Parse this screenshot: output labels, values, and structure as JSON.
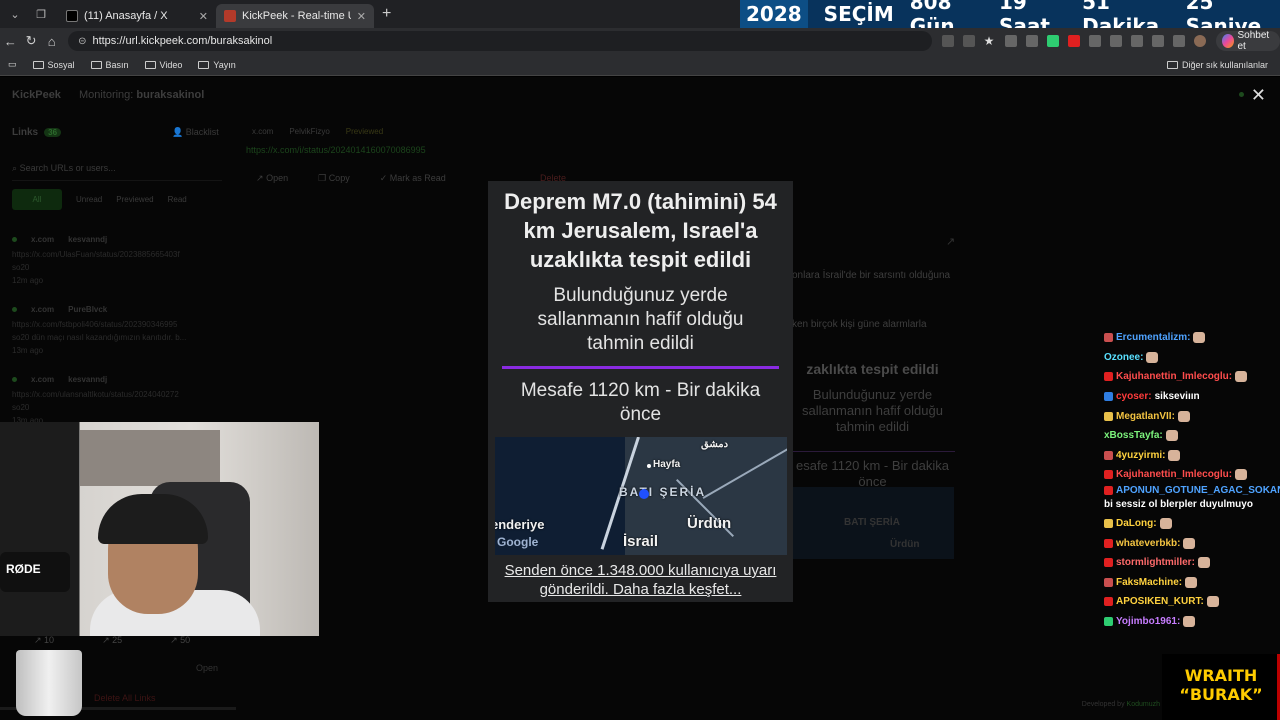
{
  "browser": {
    "tabs": [
      {
        "title": "(11) Anasayfa / X",
        "favicon_color": "#ffffff"
      },
      {
        "title": "KickPeek - Real-time URL Crawler",
        "favicon_color": "#b33a2a"
      }
    ],
    "url": "https://url.kickpeek.com/buraksakinol",
    "chat_button": "Sohbet et",
    "bookmarks": [
      "Sosyal",
      "Basın",
      "Video",
      "Yayın"
    ],
    "other_bookmarks": "Diğer sık kullanılanlar"
  },
  "countdown": {
    "year": "2028",
    "label": "SEÇİM",
    "days": "808 Gün",
    "hours": "19 Saat",
    "minutes": "51 Dakika",
    "seconds": "25 Saniye"
  },
  "app": {
    "name": "KickPeek",
    "monitoring_label": "Monitoring:",
    "monitoring_user": "buraksakinol",
    "links_label": "Links",
    "links_count": "36",
    "blacklist": "Blacklist",
    "search_placeholder": "Search URLs or users...",
    "filters": [
      "All",
      "Unread",
      "Previewed",
      "Read"
    ],
    "right_tabs": [
      "x.com",
      "PelvikFizyo",
      "Previewed"
    ],
    "selected_url": "https://x.com/i/status/2024014160070086995",
    "actions": [
      "Open",
      "Copy",
      "Mark as Read"
    ],
    "delete_label": "Delete",
    "right_snippet_1": "onlara İsrail'de bir sarsıntı olduğuna",
    "right_snippet_2": "ken birçok kişi güne alarmlarla",
    "list": [
      {
        "site": "x.com",
        "user": "kesvanndj",
        "url": "https://x.com/UlasFuan/status/2023885665403f",
        "extra": "so20",
        "time": "12m ago"
      },
      {
        "site": "x.com",
        "user": "PureBlvck",
        "url": "https://x.com/fstbpoli406/status/202390346995",
        "extra": "so20 dün maçı nasıl kazandığımızın kanıtıdır. b...",
        "time": "13m ago"
      },
      {
        "site": "x.com",
        "user": "kesvanndj",
        "url": "https://x.com/ulansnaltlkotu/status/2024040272",
        "extra": "so20",
        "time": "13m ago"
      }
    ],
    "stats": [
      "10",
      "25",
      "50"
    ],
    "open_label": "Open",
    "delete_all": "Delete All Links",
    "developed_by": "Developed by",
    "developer": "Kodumuzh"
  },
  "alert": {
    "title": "Deprem M7.0 (tahimini) 54 km Jerusalem, Israel'a uzaklıkta tespit edildi",
    "subtitle": "Bulunduğunuz yerde sallanmanın hafif olduğu tahmin edildi",
    "distance": "Mesafe 1120 km - Bir dakika önce",
    "footer": "Senden önce 1.348.000 kullanıcıya uyarı gönderildi. Daha fazla keşfet...",
    "accent": "#8a2be2",
    "map": {
      "dimashq": "دمشق",
      "hayfa": "Hayfa",
      "bati_seria": "BATI ŞERİA",
      "iskenderiye": "enderiye",
      "urdun": "Ürdün",
      "israil": "İsrail",
      "google": "Google"
    }
  },
  "ghost": {
    "title": "zaklıkta tespit edildi",
    "sub": "Bulunduğunuz yerde sallanmanın hafif olduğu tahmin edildi",
    "dist": "esafe 1120 km - Bir dakika önce",
    "map_bati": "BATI ŞERİA",
    "map_urdun": "Ürdün"
  },
  "webcam": {
    "mic_brand": "RØDE"
  },
  "chat": [
    {
      "user": "Ercumentalizm:",
      "color": "#4fa3ff",
      "text": "",
      "badge": "#c94f4f"
    },
    {
      "user": "Ozonee:",
      "color": "#59e0ff",
      "text": "",
      "badge": ""
    },
    {
      "user": "Kajuhanettin_Imlecoglu:",
      "color": "#ff4d4d",
      "text": "",
      "badge": "#e02020"
    },
    {
      "user": "cyoser:",
      "color": "#ff3b3b",
      "text": "sikseviıın",
      "badge": "#2f7de1"
    },
    {
      "user": "MegatlanVII:",
      "color": "#f5c542",
      "text": "",
      "badge": "#e8c04a"
    },
    {
      "user": "xBossTayfa:",
      "color": "#7cf27c",
      "text": "",
      "badge": ""
    },
    {
      "user": "4yuzyirmi:",
      "color": "#ffd23f",
      "text": "",
      "badge": "#c94f4f"
    },
    {
      "user": "Kajuhanettin_Imlecoglu:",
      "color": "#ff4d4d",
      "text": "",
      "badge": "#e02020"
    },
    {
      "user": "APONUN_GOTUNE_AGAC_SOKAN:",
      "color": "#4fa3ff",
      "text": "bi sessiz ol blerpler duyulmuyo",
      "badge": "#e02020"
    },
    {
      "user": "DaLong:",
      "color": "#ffd23f",
      "text": "",
      "badge": "#e8c04a"
    },
    {
      "user": "whateverbkb:",
      "color": "#f5c542",
      "text": "",
      "badge": "#e02020"
    },
    {
      "user": "stormlightmiller:",
      "color": "#ff6b6b",
      "text": "",
      "badge": "#e02020"
    },
    {
      "user": "FaksMachine:",
      "color": "#ffd23f",
      "text": "",
      "badge": "#c94f4f"
    },
    {
      "user": "APOSIKEN_KURT:",
      "color": "#ffd23f",
      "text": "",
      "badge": "#e02020"
    },
    {
      "user": "Yojimbo1961:",
      "color": "#c77dff",
      "text": "",
      "badge": "#2ecc71"
    }
  ],
  "overlay": {
    "line1": "WRAITH",
    "line2": "“BURAK”"
  }
}
